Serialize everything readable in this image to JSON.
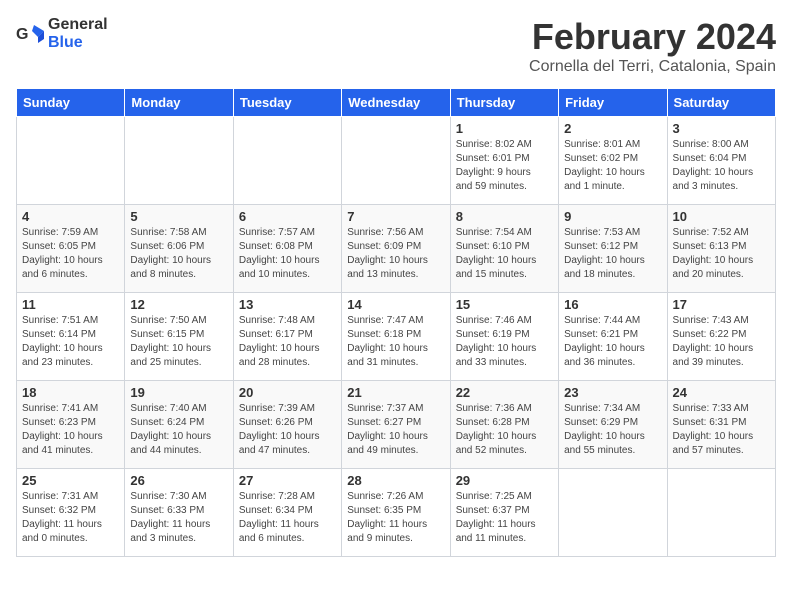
{
  "logo": {
    "text_general": "General",
    "text_blue": "Blue"
  },
  "title": "February 2024",
  "subtitle": "Cornella del Terri, Catalonia, Spain",
  "headers": [
    "Sunday",
    "Monday",
    "Tuesday",
    "Wednesday",
    "Thursday",
    "Friday",
    "Saturday"
  ],
  "weeks": [
    [
      {
        "day": "",
        "info": ""
      },
      {
        "day": "",
        "info": ""
      },
      {
        "day": "",
        "info": ""
      },
      {
        "day": "",
        "info": ""
      },
      {
        "day": "1",
        "info": "Sunrise: 8:02 AM\nSunset: 6:01 PM\nDaylight: 9 hours\nand 59 minutes."
      },
      {
        "day": "2",
        "info": "Sunrise: 8:01 AM\nSunset: 6:02 PM\nDaylight: 10 hours\nand 1 minute."
      },
      {
        "day": "3",
        "info": "Sunrise: 8:00 AM\nSunset: 6:04 PM\nDaylight: 10 hours\nand 3 minutes."
      }
    ],
    [
      {
        "day": "4",
        "info": "Sunrise: 7:59 AM\nSunset: 6:05 PM\nDaylight: 10 hours\nand 6 minutes."
      },
      {
        "day": "5",
        "info": "Sunrise: 7:58 AM\nSunset: 6:06 PM\nDaylight: 10 hours\nand 8 minutes."
      },
      {
        "day": "6",
        "info": "Sunrise: 7:57 AM\nSunset: 6:08 PM\nDaylight: 10 hours\nand 10 minutes."
      },
      {
        "day": "7",
        "info": "Sunrise: 7:56 AM\nSunset: 6:09 PM\nDaylight: 10 hours\nand 13 minutes."
      },
      {
        "day": "8",
        "info": "Sunrise: 7:54 AM\nSunset: 6:10 PM\nDaylight: 10 hours\nand 15 minutes."
      },
      {
        "day": "9",
        "info": "Sunrise: 7:53 AM\nSunset: 6:12 PM\nDaylight: 10 hours\nand 18 minutes."
      },
      {
        "day": "10",
        "info": "Sunrise: 7:52 AM\nSunset: 6:13 PM\nDaylight: 10 hours\nand 20 minutes."
      }
    ],
    [
      {
        "day": "11",
        "info": "Sunrise: 7:51 AM\nSunset: 6:14 PM\nDaylight: 10 hours\nand 23 minutes."
      },
      {
        "day": "12",
        "info": "Sunrise: 7:50 AM\nSunset: 6:15 PM\nDaylight: 10 hours\nand 25 minutes."
      },
      {
        "day": "13",
        "info": "Sunrise: 7:48 AM\nSunset: 6:17 PM\nDaylight: 10 hours\nand 28 minutes."
      },
      {
        "day": "14",
        "info": "Sunrise: 7:47 AM\nSunset: 6:18 PM\nDaylight: 10 hours\nand 31 minutes."
      },
      {
        "day": "15",
        "info": "Sunrise: 7:46 AM\nSunset: 6:19 PM\nDaylight: 10 hours\nand 33 minutes."
      },
      {
        "day": "16",
        "info": "Sunrise: 7:44 AM\nSunset: 6:21 PM\nDaylight: 10 hours\nand 36 minutes."
      },
      {
        "day": "17",
        "info": "Sunrise: 7:43 AM\nSunset: 6:22 PM\nDaylight: 10 hours\nand 39 minutes."
      }
    ],
    [
      {
        "day": "18",
        "info": "Sunrise: 7:41 AM\nSunset: 6:23 PM\nDaylight: 10 hours\nand 41 minutes."
      },
      {
        "day": "19",
        "info": "Sunrise: 7:40 AM\nSunset: 6:24 PM\nDaylight: 10 hours\nand 44 minutes."
      },
      {
        "day": "20",
        "info": "Sunrise: 7:39 AM\nSunset: 6:26 PM\nDaylight: 10 hours\nand 47 minutes."
      },
      {
        "day": "21",
        "info": "Sunrise: 7:37 AM\nSunset: 6:27 PM\nDaylight: 10 hours\nand 49 minutes."
      },
      {
        "day": "22",
        "info": "Sunrise: 7:36 AM\nSunset: 6:28 PM\nDaylight: 10 hours\nand 52 minutes."
      },
      {
        "day": "23",
        "info": "Sunrise: 7:34 AM\nSunset: 6:29 PM\nDaylight: 10 hours\nand 55 minutes."
      },
      {
        "day": "24",
        "info": "Sunrise: 7:33 AM\nSunset: 6:31 PM\nDaylight: 10 hours\nand 57 minutes."
      }
    ],
    [
      {
        "day": "25",
        "info": "Sunrise: 7:31 AM\nSunset: 6:32 PM\nDaylight: 11 hours\nand 0 minutes."
      },
      {
        "day": "26",
        "info": "Sunrise: 7:30 AM\nSunset: 6:33 PM\nDaylight: 11 hours\nand 3 minutes."
      },
      {
        "day": "27",
        "info": "Sunrise: 7:28 AM\nSunset: 6:34 PM\nDaylight: 11 hours\nand 6 minutes."
      },
      {
        "day": "28",
        "info": "Sunrise: 7:26 AM\nSunset: 6:35 PM\nDaylight: 11 hours\nand 9 minutes."
      },
      {
        "day": "29",
        "info": "Sunrise: 7:25 AM\nSunset: 6:37 PM\nDaylight: 11 hours\nand 11 minutes."
      },
      {
        "day": "",
        "info": ""
      },
      {
        "day": "",
        "info": ""
      }
    ]
  ]
}
